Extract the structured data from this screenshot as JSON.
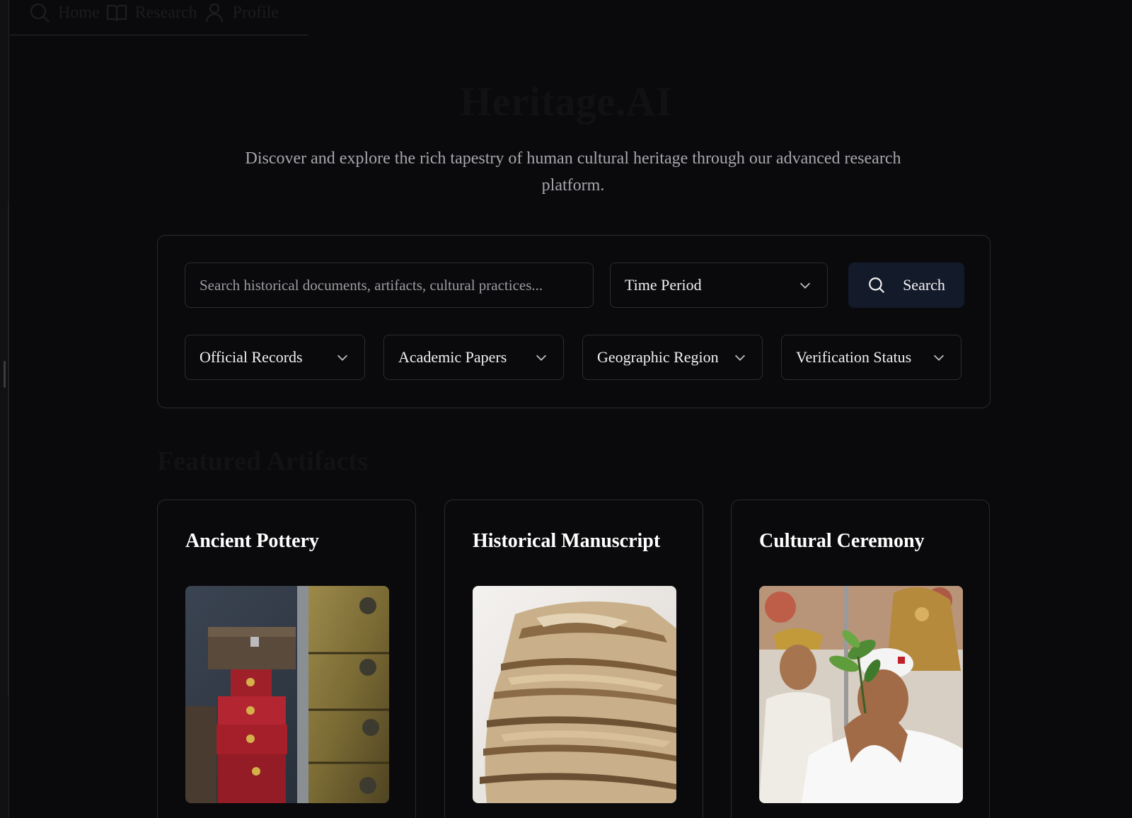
{
  "nav": {
    "items": [
      {
        "label": "Home",
        "icon": "search-icon"
      },
      {
        "label": "Research",
        "icon": "book-icon"
      },
      {
        "label": "Profile",
        "icon": "user-icon"
      }
    ]
  },
  "hero": {
    "title": "Heritage.AI",
    "subtitle": "Discover and explore the rich tapestry of human cultural heritage through our advanced research platform."
  },
  "search": {
    "placeholder": "Search historical documents, artifacts, cultural practices...",
    "time_period": "Time Period",
    "button_label": "Search",
    "filters": [
      "Official Records",
      "Academic Papers",
      "Geographic Region",
      "Verification Status"
    ]
  },
  "featured": {
    "title": "Featured Artifacts",
    "cards": [
      {
        "title": "Ancient Pottery"
      },
      {
        "title": "Historical Manuscript"
      },
      {
        "title": "Cultural Ceremony"
      }
    ]
  },
  "colors": {
    "background": "#0a0a0c",
    "panel_border": "#2a2a30",
    "search_button": "#131a2a",
    "subtitle": "#a6a6ad"
  }
}
